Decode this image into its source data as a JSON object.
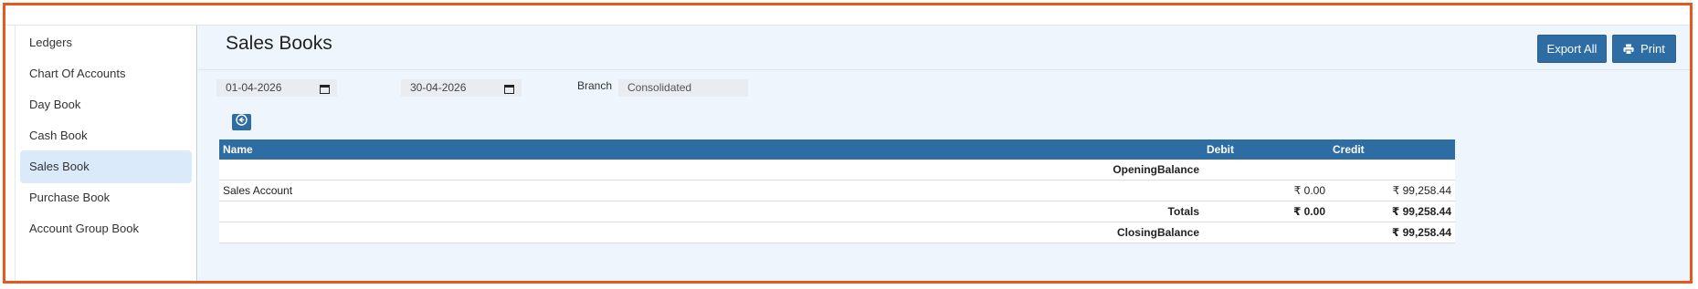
{
  "sidebar": {
    "items": [
      {
        "label": "Ledgers"
      },
      {
        "label": "Chart Of Accounts"
      },
      {
        "label": "Day Book"
      },
      {
        "label": "Cash Book"
      },
      {
        "label": "Sales Book",
        "active": true
      },
      {
        "label": "Purchase Book"
      },
      {
        "label": "Account Group Book"
      }
    ]
  },
  "header": {
    "title": "Sales Books",
    "export_label": "Export All",
    "print_label": "Print"
  },
  "filters": {
    "from_date": "01-04-2026",
    "to_date": "30-04-2026",
    "branch_label": "Branch",
    "branch_value": "Consolidated"
  },
  "table": {
    "columns": [
      "Name",
      "Debit",
      "Credit"
    ],
    "opening_label": "OpeningBalance",
    "rows": [
      {
        "name": "Sales Account",
        "debit": "₹ 0.00",
        "credit": "₹ 99,258.44"
      }
    ],
    "totals_label": "Totals",
    "totals_debit": "₹ 0.00",
    "totals_credit": "₹ 99,258.44",
    "closing_label": "ClosingBalance",
    "closing_credit": "₹ 99,258.44"
  },
  "colors": {
    "accent": "#2e6da4",
    "frame_border": "#e8571c",
    "active_item_bg": "#dbeafb",
    "content_bg": "#eef5fc"
  },
  "icons": [
    "printer-icon",
    "calendar-icon",
    "arrow-left-circle-icon"
  ]
}
